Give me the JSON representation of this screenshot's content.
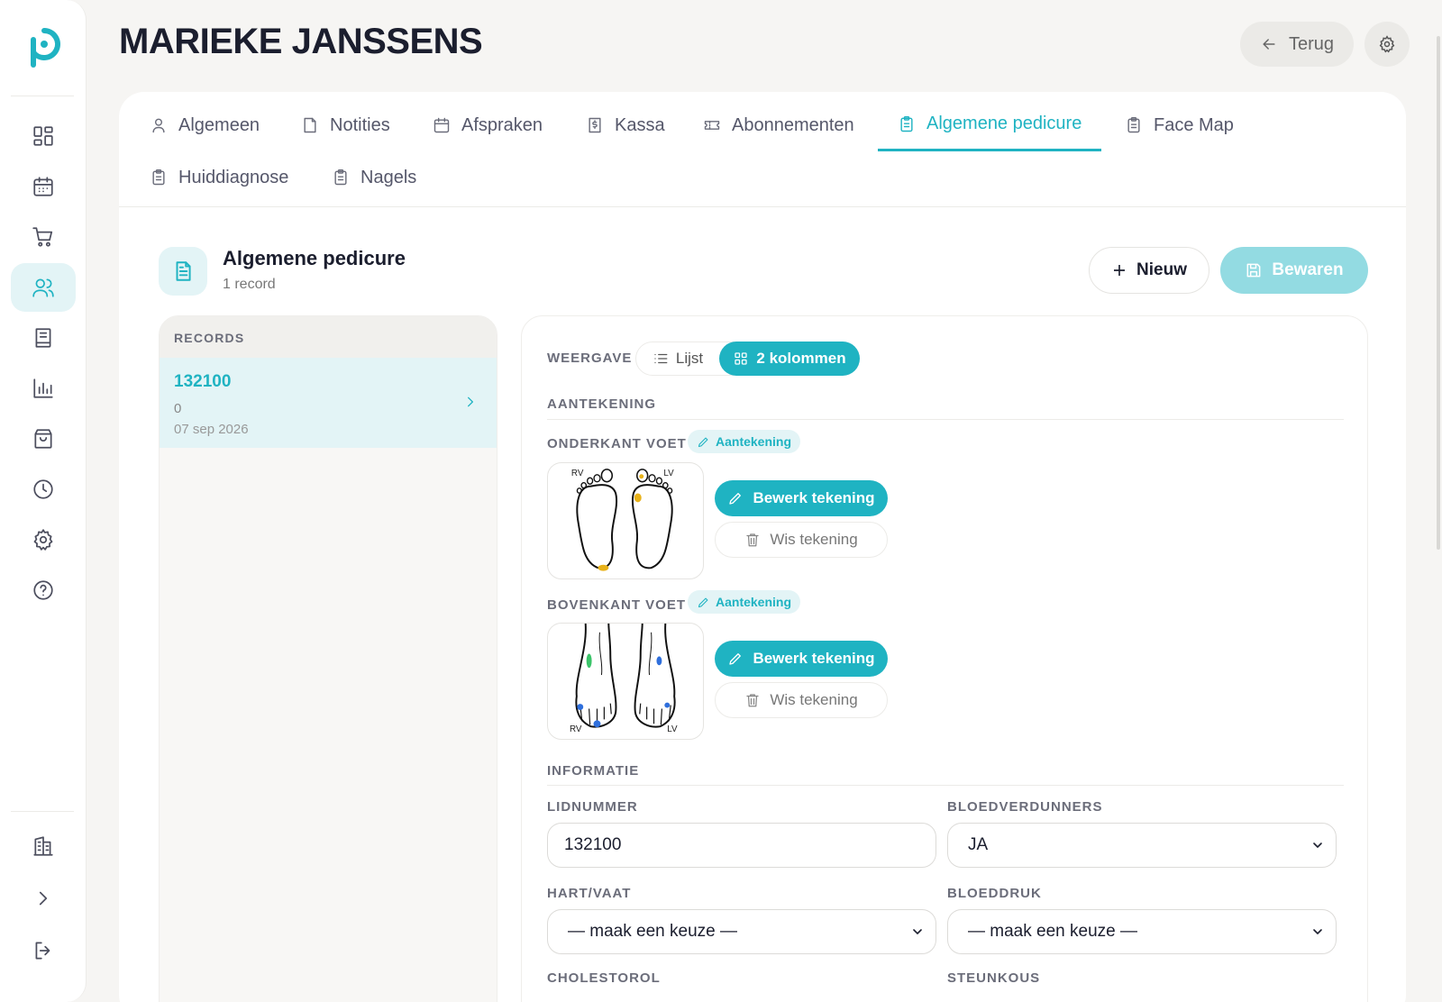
{
  "header": {
    "title": "MARIEKE JANSSENS",
    "back_label": "Terug"
  },
  "sidebar": {
    "items": [
      {
        "name": "dashboard-icon"
      },
      {
        "name": "calendar-icon"
      },
      {
        "name": "cart-icon"
      },
      {
        "name": "users-icon",
        "active": true
      },
      {
        "name": "book-icon"
      },
      {
        "name": "chart-icon"
      },
      {
        "name": "bag-icon"
      },
      {
        "name": "clock-icon"
      },
      {
        "name": "gear-icon"
      },
      {
        "name": "help-icon"
      }
    ],
    "bottom": [
      {
        "name": "building-icon"
      },
      {
        "name": "chevron-right-icon"
      },
      {
        "name": "logout-icon"
      }
    ]
  },
  "tabs": [
    {
      "label": "Algemeen",
      "icon": "user-icon"
    },
    {
      "label": "Notities",
      "icon": "note-icon"
    },
    {
      "label": "Afspraken",
      "icon": "calendar-icon"
    },
    {
      "label": "Kassa",
      "icon": "receipt-icon"
    },
    {
      "label": "Abonnementen",
      "icon": "ticket-icon"
    },
    {
      "label": "Algemene pedicure",
      "icon": "clipboard-icon",
      "active": true
    },
    {
      "label": "Face Map",
      "icon": "clipboard-icon"
    },
    {
      "label": "Huiddiagnose",
      "icon": "clipboard-icon"
    },
    {
      "label": "Nagels",
      "icon": "clipboard-icon"
    }
  ],
  "section": {
    "title": "Algemene pedicure",
    "subtitle": "1 record",
    "new_label": "Nieuw",
    "save_label": "Bewaren"
  },
  "records": {
    "header": "RECORDS",
    "items": [
      {
        "id": "132100",
        "value": "0",
        "date": "07 sep 2026"
      }
    ]
  },
  "form": {
    "view_label": "WEERGAVE",
    "view_options": [
      "Lijst",
      "2 kolommen"
    ],
    "view_selected": "2 kolommen",
    "annotation_heading": "AANTEKENING",
    "onderkant": {
      "label": "ONDERKANT VOET",
      "chip": "Aantekening",
      "left_tag": "RV",
      "right_tag": "LV",
      "edit_label": "Bewerk tekening",
      "clear_label": "Wis tekening"
    },
    "bovenkant": {
      "label": "BOVENKANT VOET",
      "chip": "Aantekening",
      "left_tag": "RV",
      "right_tag": "LV",
      "edit_label": "Bewerk tekening",
      "clear_label": "Wis tekening"
    },
    "info_heading": "INFORMATIE",
    "fields": {
      "lidnummer": {
        "label": "LIDNUMMER",
        "value": "132100"
      },
      "bloedverdunners": {
        "label": "BLOEDVERDUNNERS",
        "value": "JA"
      },
      "hartvaat": {
        "label": "HART/VAAT",
        "value": "— maak een keuze —"
      },
      "bloeddruk": {
        "label": "BLOEDDRUK",
        "value": "— maak een keuze —"
      },
      "cholesterol": {
        "label": "CHOLESTOROL"
      },
      "steunkous": {
        "label": "STEUNKOUS"
      }
    }
  },
  "colors": {
    "accent": "#1fb3c2",
    "accent_light": "#e3f4f6",
    "mark_yellow": "#e8b21a",
    "mark_green": "#3cc46a",
    "mark_blue": "#2f6fdc"
  }
}
